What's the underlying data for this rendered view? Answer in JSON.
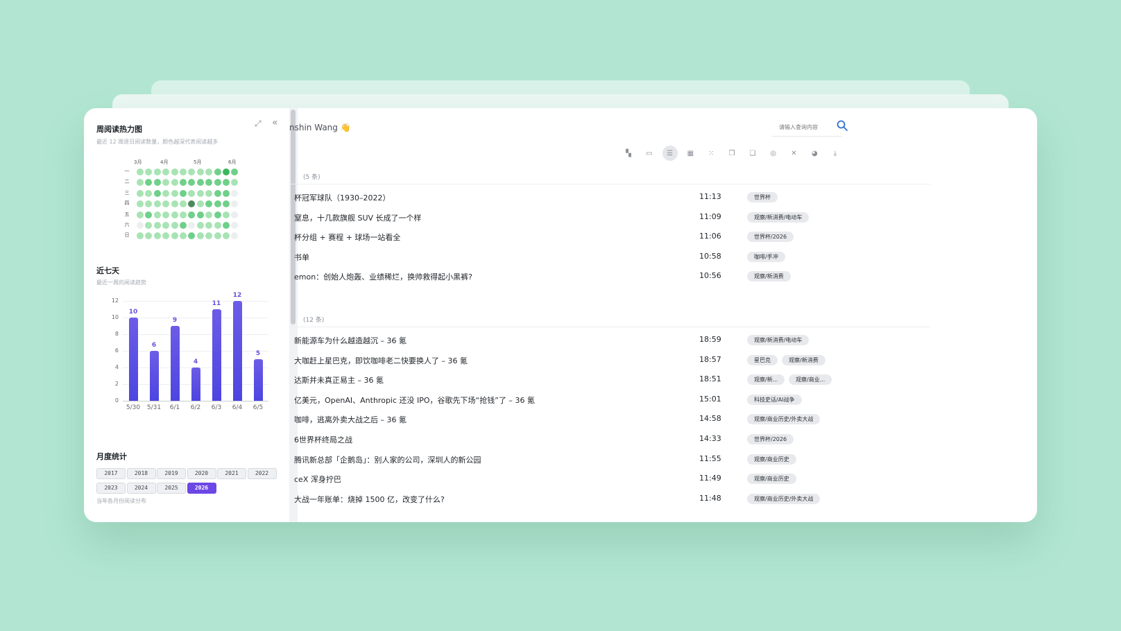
{
  "sidebar": {
    "heatmap": {
      "title": "周阅读热力图",
      "subtitle": "最近 12 周逐日阅读数量，颜色越深代表阅读越多",
      "months": [
        "3月",
        "4月",
        "5月",
        "6月"
      ],
      "days": [
        "一",
        "二",
        "三",
        "四",
        "五",
        "六",
        "日"
      ],
      "grid": [
        [
          1,
          1,
          1,
          1,
          1,
          1,
          1,
          1,
          1,
          2,
          3,
          2
        ],
        [
          1,
          2,
          2,
          1,
          1,
          2,
          2,
          2,
          2,
          2,
          2,
          1
        ],
        [
          1,
          1,
          2,
          1,
          1,
          2,
          1,
          1,
          1,
          2,
          2,
          0
        ],
        [
          1,
          1,
          1,
          1,
          1,
          1,
          4,
          1,
          2,
          2,
          2,
          0
        ],
        [
          1,
          2,
          1,
          1,
          1,
          1,
          2,
          2,
          1,
          2,
          1,
          0
        ],
        [
          0,
          1,
          1,
          1,
          1,
          2,
          0,
          1,
          1,
          1,
          2,
          0
        ],
        [
          1,
          1,
          1,
          1,
          1,
          1,
          2,
          1,
          1,
          1,
          1,
          0
        ]
      ]
    },
    "weekly": {
      "title": "近七天",
      "subtitle": "最近一周的阅读趋势"
    },
    "monthly": {
      "title": "月度统计",
      "years": [
        "2017",
        "2018",
        "2019",
        "2020",
        "2021",
        "2022",
        "2023",
        "2024",
        "2025",
        "2026"
      ],
      "active_year": "2026",
      "subtitle": "当年各月份阅读分布"
    }
  },
  "chart_data": {
    "type": "bar",
    "categories": [
      "5/30",
      "5/31",
      "6/1",
      "6/2",
      "6/3",
      "6/4",
      "6/5"
    ],
    "values": [
      10,
      6,
      9,
      4,
      11,
      12,
      5
    ],
    "ylim": [
      0,
      12
    ],
    "yticks": [
      0,
      2,
      4,
      6,
      8,
      10,
      12
    ],
    "grid": true,
    "color": "#5a4ee6"
  },
  "header": {
    "title": "nshin Wang 👋",
    "search_placeholder": "请输入查询内容"
  },
  "toolbar_icons": [
    "dashboard-icon",
    "card-icon",
    "list-icon",
    "table-icon",
    "grid-icon",
    "copy-icon",
    "window-icon",
    "fingerprint-icon",
    "close-icon",
    "pie-chart-icon",
    "download-icon"
  ],
  "groups": [
    {
      "count": "(5 条)",
      "rows": [
        {
          "title": "杯冠军球队（1930–2022）",
          "time": "11:13",
          "tags": [
            "世界杯"
          ]
        },
        {
          "title": "窒息，十几款旗舰 SUV 长成了一个样",
          "time": "11:09",
          "tags": [
            "观察/新消费/电动车"
          ]
        },
        {
          "title": "杯分组 + 赛程 + 球场一站看全",
          "time": "11:06",
          "tags": [
            "世界杯/2026"
          ]
        },
        {
          "title": "书单",
          "time": "10:58",
          "tags": [
            "咖啡/手冲"
          ]
        },
        {
          "title": "emon：创始人炮轰、业绩稀烂，换帅救得起小黑裤?",
          "time": "10:56",
          "tags": [
            "观察/新消费"
          ]
        }
      ]
    },
    {
      "count": "(12 条)",
      "rows": [
        {
          "title": "新能源车为什么越造越沉 – 36 氪",
          "time": "18:59",
          "tags": [
            "观察/新消费/电动车"
          ]
        },
        {
          "title": "大咖赶上星巴克，即饮咖啡老二快要换人了 – 36 氪",
          "time": "18:57",
          "tags": [
            "星巴克",
            "观察/新消费"
          ]
        },
        {
          "title": "达斯并未真正易主 – 36 氪",
          "time": "18:51",
          "tags": [
            "观察/新...",
            "观察/商业..."
          ]
        },
        {
          "title": "亿美元，OpenAI、Anthropic 还没 IPO，谷歌先下场“抢钱”了 – 36 氪",
          "time": "15:01",
          "tags": [
            "科技史话/AI战争"
          ]
        },
        {
          "title": "咖啡，逃离外卖大战之后 – 36 氪",
          "time": "14:58",
          "tags": [
            "观察/商业历史/外卖大战"
          ]
        },
        {
          "title": "6世界杯终局之战",
          "time": "14:33",
          "tags": [
            "世界杯/2026"
          ]
        },
        {
          "title": "腾讯新总部「企鹅岛」：别人家的公司，深圳人的新公园",
          "time": "11:55",
          "tags": [
            "观察/商业历史"
          ]
        },
        {
          "title": "ceX 浑身拧巴",
          "time": "11:49",
          "tags": [
            "观察/商业历史"
          ]
        },
        {
          "title": "大战一年账单：烧掉 1500 亿，改变了什么?",
          "time": "11:48",
          "tags": [
            "观察/商业历史/外卖大战"
          ]
        }
      ]
    }
  ]
}
